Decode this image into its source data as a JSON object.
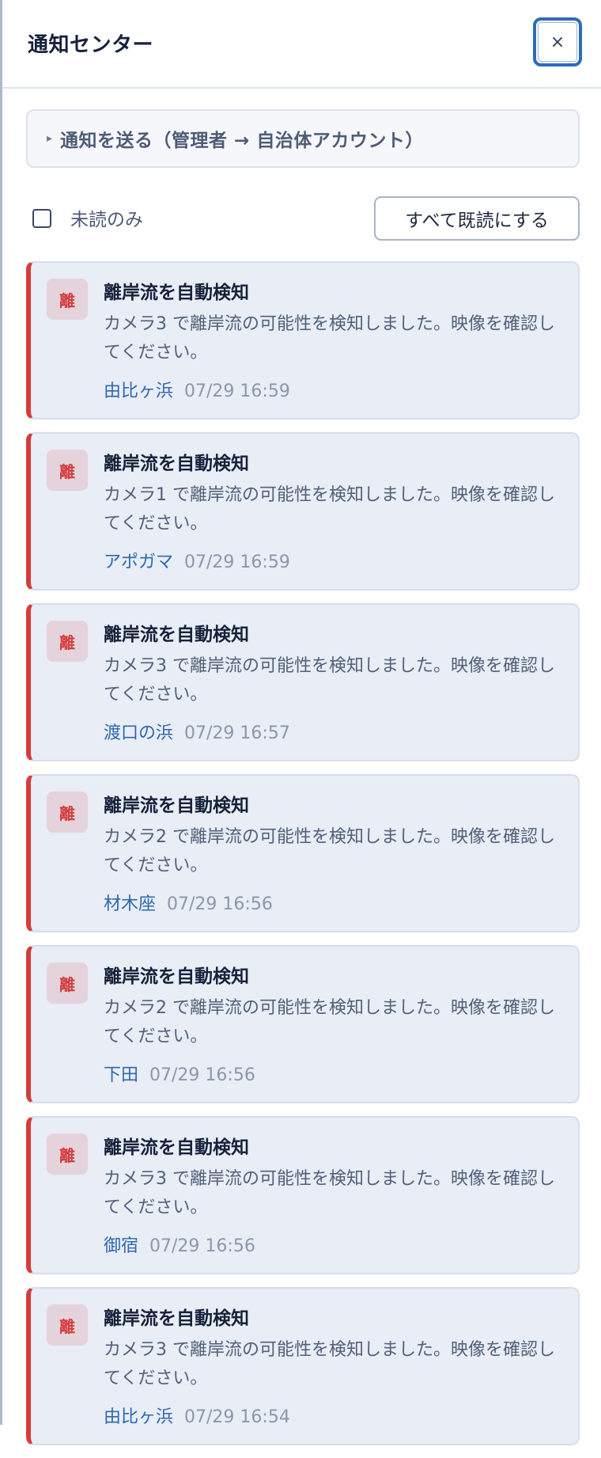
{
  "header": {
    "title": "通知センター",
    "close_label": "×"
  },
  "send_section": {
    "caret": "▸",
    "label": "通知を送る（管理者 → 自治体アカウント）"
  },
  "toolbar": {
    "unread_only_label": "未読のみ",
    "unread_only_checked": false,
    "mark_all_read_label": "すべて既読にする"
  },
  "colors": {
    "accent_red": "#d43d3d",
    "location_blue": "#2e68b0",
    "card_background": "#e8edf6"
  },
  "notifications": [
    {
      "badge": "離",
      "title": "離岸流を自動検知",
      "body": "カメラ3 で離岸流の可能性を検知しました。映像を確認してください。",
      "location": "由比ヶ浜",
      "time": "07/29 16:59"
    },
    {
      "badge": "離",
      "title": "離岸流を自動検知",
      "body": "カメラ1 で離岸流の可能性を検知しました。映像を確認してください。",
      "location": "アポガマ",
      "time": "07/29 16:59"
    },
    {
      "badge": "離",
      "title": "離岸流を自動検知",
      "body": "カメラ3 で離岸流の可能性を検知しました。映像を確認してください。",
      "location": "渡口の浜",
      "time": "07/29 16:57"
    },
    {
      "badge": "離",
      "title": "離岸流を自動検知",
      "body": "カメラ2 で離岸流の可能性を検知しました。映像を確認してください。",
      "location": "材木座",
      "time": "07/29 16:56"
    },
    {
      "badge": "離",
      "title": "離岸流を自動検知",
      "body": "カメラ2 で離岸流の可能性を検知しました。映像を確認してください。",
      "location": "下田",
      "time": "07/29 16:56"
    },
    {
      "badge": "離",
      "title": "離岸流を自動検知",
      "body": "カメラ3 で離岸流の可能性を検知しました。映像を確認してください。",
      "location": "御宿",
      "time": "07/29 16:56"
    },
    {
      "badge": "離",
      "title": "離岸流を自動検知",
      "body": "カメラ3 で離岸流の可能性を検知しました。映像を確認してください。",
      "location": "由比ヶ浜",
      "time": "07/29 16:54"
    }
  ]
}
